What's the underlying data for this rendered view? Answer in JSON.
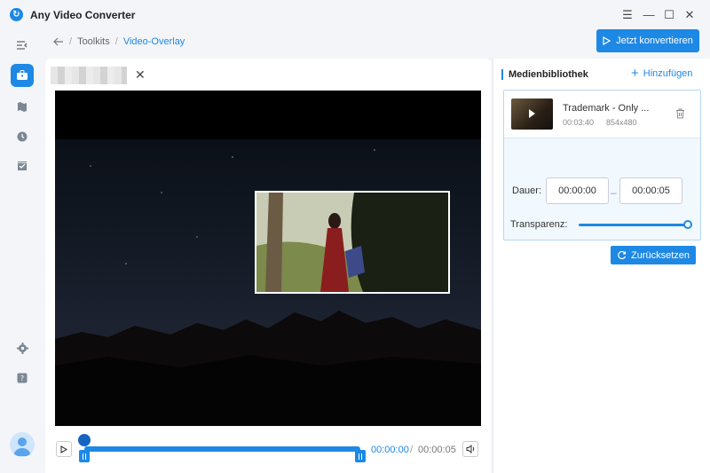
{
  "app": {
    "title": "Any Video Converter"
  },
  "breadcrumb": {
    "root": "Toolkits",
    "sep": "/",
    "current": "Video-Overlay"
  },
  "toolbar": {
    "convert_label": "Jetzt konvertieren"
  },
  "player": {
    "current_time": "00:00:00",
    "separator": "/",
    "total_time": "00:00:05",
    "progress": 0.0
  },
  "media_library": {
    "title": "Medienbibliothek",
    "add_label": "Hinzufügen",
    "item": {
      "name": "Trademark - Only ...",
      "duration": "00:03:40",
      "resolution": "854x480"
    },
    "duration_label": "Dauer:",
    "start_time": "00:00:00",
    "end_time": "00:00:05",
    "range_dash": "–",
    "transparency_label": "Transparenz:",
    "transparency_value": 1.0,
    "reset_label": "Zurücksetzen"
  },
  "colors": {
    "accent": "#1e88e5",
    "background": "#f3f5f8"
  }
}
